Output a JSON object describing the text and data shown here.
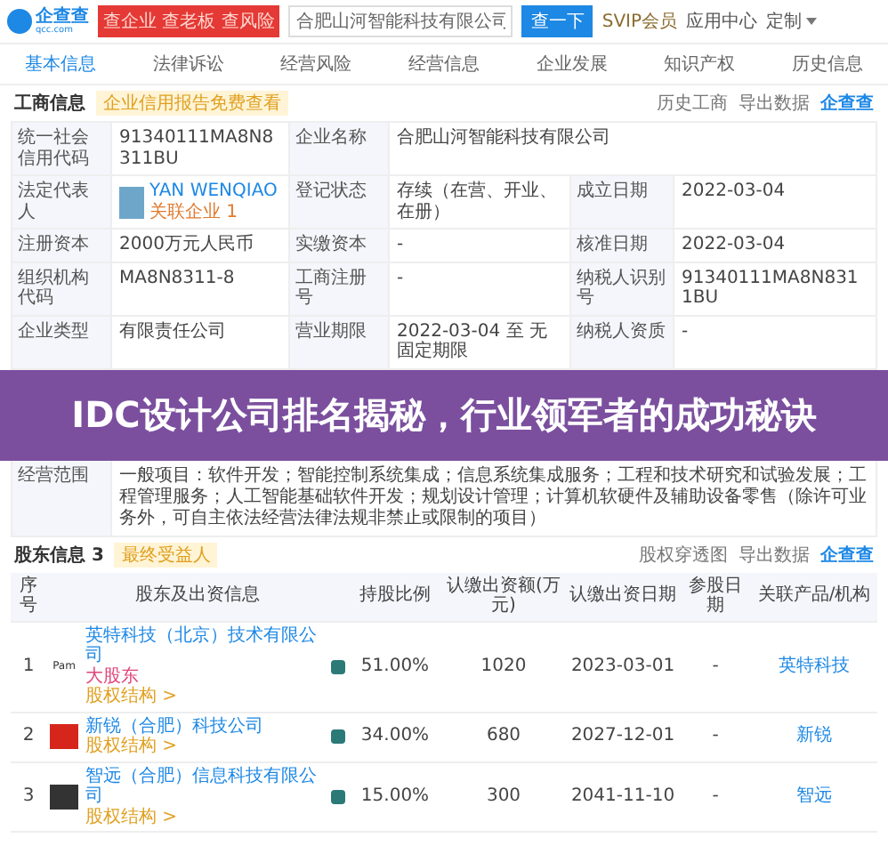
{
  "header": {
    "logo": "企查查",
    "logo_sub": "qcc.com",
    "promo": "查企业 查老板 查风险",
    "search": {
      "value": "合肥山河智能科技有限公司"
    },
    "search_button": "查一下",
    "svip": "SVIP会员",
    "app_center": "应用中心",
    "custom": "定制"
  },
  "tabs": [
    {
      "label": "基本信息",
      "selected": true
    },
    {
      "label": "法律诉讼",
      "selected": false
    },
    {
      "label": "经营风险",
      "selected": false
    },
    {
      "label": "经营信息",
      "selected": false
    },
    {
      "label": "企业发展",
      "selected": false
    },
    {
      "label": "知识产权",
      "selected": false
    },
    {
      "label": "历史信息",
      "selected": false
    }
  ],
  "business_info": {
    "title": "工商信息",
    "tag": "企业信用报告免费查看",
    "history": "历史工商",
    "export": "导出数据",
    "brand": "企查查",
    "rows": [
      [
        {
          "label": "统一社会信用代码",
          "value": "91340111MA8N8311BU"
        },
        {
          "label": "企业名称",
          "value": "合肥山河智能科技有限公司"
        }
      ],
      [
        {
          "label": "法定代表人",
          "value": "YAN WENQIAO",
          "sub": "关联企业 1"
        },
        {
          "label": "登记状态",
          "value": "存续（在营、开业、在册）"
        },
        {
          "label": "成立日期",
          "value": "2022-03-04"
        }
      ],
      [
        {
          "label": "注册资本",
          "value": "2000万元人民币"
        },
        {
          "label": "实缴资本",
          "value": "-"
        },
        {
          "label": "核准日期",
          "value": "2022-03-04"
        }
      ],
      [
        {
          "label": "组织机构代码",
          "value": "MA8N8311-8"
        },
        {
          "label": "工商注册号",
          "value": "-"
        },
        {
          "label": "纳税人识别号",
          "value": "91340111MA8N8311BU"
        }
      ],
      [
        {
          "label": "企业类型",
          "value": "有限责任公司"
        },
        {
          "label": "营业期限",
          "value": "2022-03-04 至 无固定期限"
        },
        {
          "label": "纳税人资质",
          "value": "-"
        }
      ]
    ],
    "overlay_title": "IDC设计公司排名揭秘，行业领军者的成功秘诀",
    "scope": {
      "label": "经营范围",
      "value": "一般项目：软件开发；智能控制系统集成；信息系统集成服务；工程和技术研究和试验发展；工程管理服务；人工智能基础软件开发；规划设计管理；计算机软硬件及辅助设备零售（除许可业务外，可自主依法经营法律法规非禁止或限制的项目）"
    }
  },
  "shareholders": {
    "title": "股东信息",
    "count": "3",
    "tag": "最终受益人",
    "filter": "股权穿透图",
    "export": "导出数据",
    "brand": "企查查",
    "columns": [
      "序号",
      "股东及出资信息",
      "持股比例",
      "认缴出资额(万元)",
      "认缴出资日期",
      "参股日期",
      "关联产品/机构"
    ],
    "rows": [
      {
        "index": "1",
        "logo": "Pam",
        "color": "#ffffff",
        "name": "英特科技（北京）技术有限公司",
        "tag": "大股东",
        "link": "股权结构 >",
        "ratio": "51.00%",
        "amount": "1020",
        "date": "2023-03-01",
        "join": "-",
        "product": "英特科技"
      },
      {
        "index": "2",
        "color": "#d6261c",
        "name": "新锐（合肥）科技公司",
        "link": "股权结构 >",
        "ratio": "34.00%",
        "amount": "680",
        "date": "2027-12-01",
        "join": "-",
        "product": "新锐"
      },
      {
        "index": "3",
        "color": "#333333",
        "name": "智远（合肥）信息科技有限公司",
        "link": "股权结构 >",
        "ratio": "15.00%",
        "amount": "300",
        "date": "2041-11-10",
        "join": "-",
        "product": "智远"
      }
    ]
  }
}
